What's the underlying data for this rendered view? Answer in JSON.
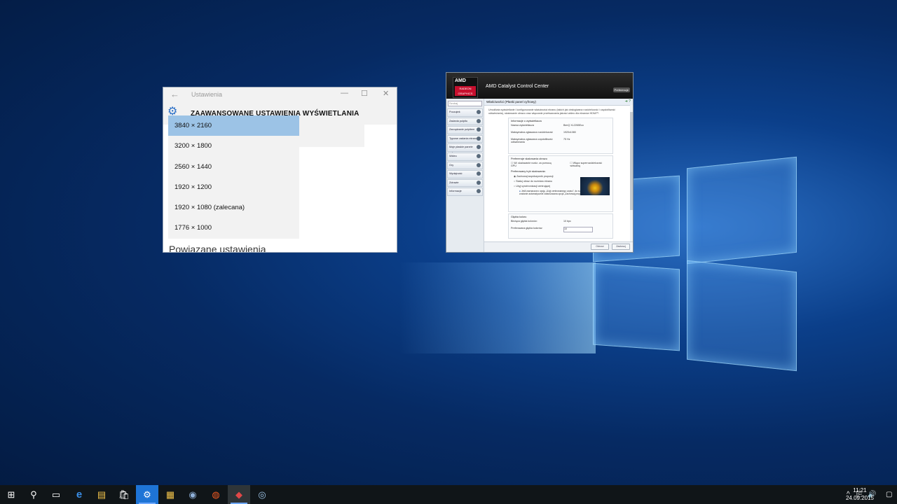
{
  "settings_window": {
    "title": "Ustawienia",
    "back_glyph": "←",
    "header": "ZAAWANSOWANE USTAWIENIA WYŚWIETLANIA",
    "minimize_glyph": "—",
    "maximize_glyph": "☐",
    "close_glyph": "✕",
    "gear_glyph": "⚙",
    "resolution_options": [
      {
        "label": "3840 × 2160",
        "selected": true
      },
      {
        "label": "3200 × 1800"
      },
      {
        "label": "2560 × 1440"
      },
      {
        "label": "1920 × 1200"
      },
      {
        "label": "1920 × 1080 (zalecana)"
      },
      {
        "label": "1776 × 1000"
      }
    ],
    "related_heading": "Powiązane ustawienia"
  },
  "amd_window": {
    "logo_text": "AMD",
    "radeon_text": "RADEON GRAPHICS",
    "app_title": "AMD Catalyst Control Center",
    "preferences_label": "Preferencje",
    "search_placeholder": "Szukaj",
    "nav_items": [
      "Początek",
      "Zadania pulpitu",
      "Zarządzanie pulpitem",
      "Typowe zadania ekranu",
      "Moje płaskie panele cyfrowe",
      "Wideo",
      "Gry",
      "Wydajność",
      "Zdrowie",
      "Informacje"
    ],
    "page_title": "Właściwości (Płaski panel cyfrowy)",
    "description": "Umożliwia wyświetlanie i konfigurowanie właściwości ekranu (takich jak obsługiwana rozdzielczość i częstotliwość odświeżania), skalowanie obrazu oraz włączanie przetwarzania jakości wideo dla ekranów HDMI™.",
    "info_section": {
      "title": "Informacje o wyświetlaczu",
      "rows": [
        {
          "k": "Nazwa wyświetlacza",
          "v": "BenQ XL2265Eco"
        },
        {
          "k": "Maksymalna zgłaszana rozdzielczość",
          "v": "1920x1080"
        },
        {
          "k": "Maksymalna zgłaszana częstotliwość odświeżania",
          "v": "75 Hz"
        }
      ]
    },
    "scaling_section": {
      "title": "Preferencje skalowania obrazu",
      "check1": "Wł. skalowanie rozdz. za pomocą GPU",
      "check2": "Włącz superrozdzielczość wirtualną",
      "mode_title": "Preferowany tryb skalowania:",
      "radios": [
        "Zachowaj współczynnik proporcji",
        "Skaluj obraz do rozmiaru ekranu",
        "Użyj synchronizacji centrującej"
      ],
      "note": "Jeśli zaznaczono opcję „Użyj centrowanego czasu”, do superrozdzielczości wirtualnej zostanie automatycznie zastosowana opcja „Zachowaj proporcje obrazu”."
    },
    "color_section": {
      "title": "Głębia koloru",
      "current_label": "Bieżąca głębia kolorów:",
      "current_value": "10 bpc",
      "pref_label": "Preferowana głębia kolorów:",
      "pref_value": "10"
    },
    "discard_label": "Odrzuć",
    "apply_label": "Zastosuj"
  },
  "taskbar": {
    "start_glyph": "⊞",
    "search_glyph": "⚲",
    "taskview_glyph": "▭",
    "edge_glyph": "e",
    "explorer_glyph": "▤",
    "store_glyph": "🛍",
    "settings_glyph": "⚙",
    "app1_glyph": "▦",
    "steam_glyph": "◉",
    "origin_glyph": "◍",
    "amd_glyph": "◆",
    "app2_glyph": "◎",
    "clock_time": "11:21",
    "clock_date": "24.09.2015",
    "tray_up_glyph": "^",
    "tray_net_glyph": "⎘",
    "tray_vol_glyph": "🔊",
    "tray_notif_glyph": "▢"
  }
}
